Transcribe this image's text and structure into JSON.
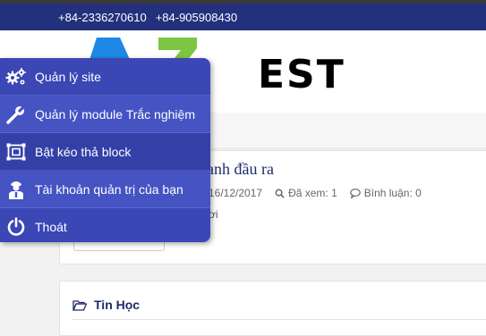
{
  "topbar": {
    "phone1": "+84-2336270610",
    "phone2": "+84-905908430",
    "background": "#23317c"
  },
  "logo": {
    "word": "EST",
    "colors": {
      "blue": "#1e88e5",
      "green": "#7cc642"
    }
  },
  "admin_menu": {
    "items": [
      {
        "label": "Quản lý site",
        "icon": "gears-icon"
      },
      {
        "label": "Quản lý module Trắc nghiệm",
        "icon": "wrench-icon"
      },
      {
        "label": "Bật kéo thả block",
        "icon": "drag-block-icon"
      },
      {
        "label": "Tài khoản quản trị của bạn",
        "icon": "admin-user-icon"
      },
      {
        "label": "Thoát",
        "icon": "power-icon"
      }
    ],
    "background": "#3a47b5"
  },
  "article": {
    "title": "anh đầu ra",
    "date": "16/12/2017",
    "views_label": "Đã xem: 1",
    "comments_label": "Bình luận: 0",
    "snippet": "ơi"
  },
  "category": {
    "label": "Tin Học"
  }
}
